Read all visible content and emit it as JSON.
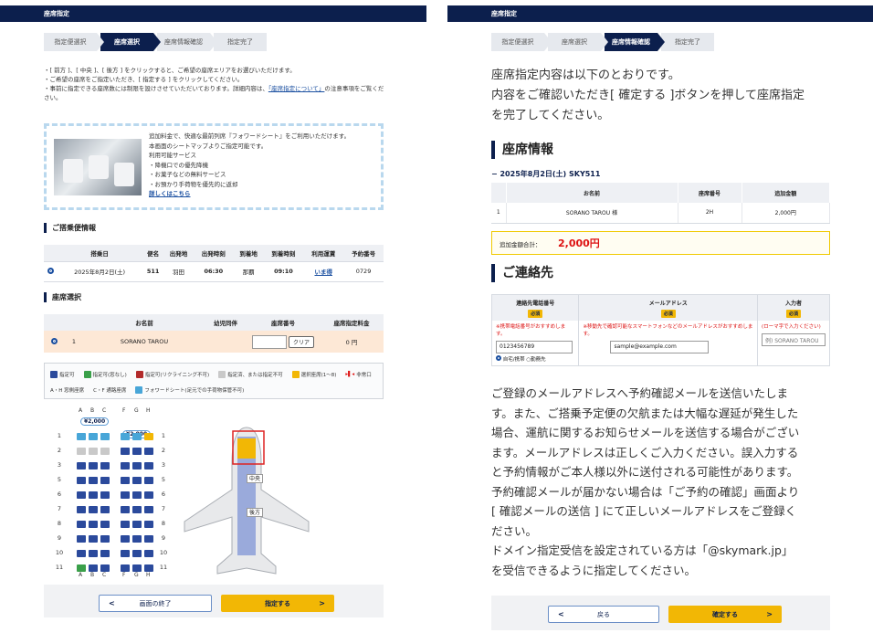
{
  "left": {
    "header_title": "座席指定",
    "steps": [
      "指定便選択",
      "座席選択",
      "座席情報確認",
      "指定完了"
    ],
    "notes": [
      "・[ 前方 ]、[ 中央 ]、[ 後方 ] をクリックすると、ご希望の座席エリアをお選びいただけます。",
      "・ご希望の座席をご指定いただき、[ 指定する ] をクリックしてください。",
      "・事前に指定できる座席数には制限を設けさせていただいております。詳細内容は、"
    ],
    "notes_link": "「座席指定について」",
    "notes_tail": "の注意事項をご覧ください。",
    "promo_lines": [
      "追加料金で、快適な最前列席『フォワードシート』をご利用いただけます。",
      "本画面のシートマップよりご指定可能です。",
      "利用可能サービス",
      "・降機口での優先降機",
      "・お菓子などの無料サービス",
      "・お預かり手荷物を優先的に返却"
    ],
    "promo_link": "詳しくはこちら",
    "flight_section": "ご搭乗便情報",
    "flight_headers": [
      "",
      "搭乗日",
      "便名",
      "出発地",
      "出発時刻",
      "到着地",
      "到着時刻",
      "利用運賃",
      "予約番号"
    ],
    "flight_row": {
      "date": "2025年8月2日(土)",
      "flight": "511",
      "from": "羽田",
      "dep": "06:30",
      "to": "那覇",
      "arr": "09:10",
      "fare": "いま得",
      "resno": "0729"
    },
    "seat_section": "座席選択",
    "seat_headers": [
      "",
      "",
      "お名前",
      "幼児同伴",
      "座席番号",
      "座席指定料金"
    ],
    "seat_row": {
      "no": "1",
      "name": "SORANO TAROU",
      "clear": "クリア",
      "fee": "0 円"
    },
    "legend": [
      "指定可",
      "指定可(窓なし)",
      "指定可(リクライニング不可)",
      "指定済、または指定不可",
      "選択座席(1〜8)",
      "非常口",
      "A・H 窓側座席",
      "C・F 通路座席",
      "フォワードシート(足元での手荷物保管不可)"
    ],
    "seat_cols": [
      "A",
      "B",
      "C",
      "F",
      "G",
      "H"
    ],
    "rows": [
      "1",
      "2",
      "3",
      "5",
      "6",
      "7",
      "8",
      "9",
      "10",
      "11"
    ],
    "forward_price": "¥2,000",
    "plane_mid": "中央",
    "plane_rear": "後方",
    "btn_back": "画面の終了",
    "btn_next": "指定する",
    "colors": {
      "available": "#2b4a9c",
      "no_window": "#3aa04a",
      "no_recline": "#b22b2b",
      "taken": "#c9c9c9",
      "selected": "#f2b705",
      "forward": "#48a6d8"
    }
  },
  "right": {
    "header_title": "座席指定",
    "steps": [
      "指定便選択",
      "座席選択",
      "座席情報確認",
      "指定完了"
    ],
    "intro": [
      "座席指定内容は以下のとおりです。",
      "内容をご確認いただき[ 確定する ]ボタンを押して座席指定",
      "を完了してください。"
    ],
    "seat_info_title": "座席情報",
    "flight_line": "− 2025年8月2日(土) SKY511",
    "table_headers": [
      "",
      "お名前",
      "座席番号",
      "追加金額"
    ],
    "table_row": {
      "no": "1",
      "name": "SORANO TAROU 様",
      "seat": "2H",
      "fee": "2,000円"
    },
    "total_label": "追加金額合計：",
    "total_value": "2,000円",
    "contact_title": "ご連絡先",
    "contact_headers": [
      "連絡先電話番号",
      "メールアドレス",
      "入力者"
    ],
    "required": "必須",
    "phone_warn": "※携帯電話番号がおすすめします。",
    "email_warn": "※移動先で確認可能なスマートフォンなどのメールアドレスがおすすめします。",
    "name_warn": "(ローマ字で入力ください)",
    "phone_value": "0123456789",
    "phone_opts": [
      "自宅/携帯",
      "勤務先"
    ],
    "email_value": "sample@example.com",
    "name_placeholder": "例) SORANO TAROU",
    "body": [
      "ご登録のメールアドレスへ予約確認メールを送信いたしま",
      "す。また、ご搭乗予定便の欠航または大幅な遅延が発生した",
      "場合、運航に関するお知らせメールを送信する場合がござい",
      "ます。メールアドレスは正しくご入力ください。誤入力する",
      "と予約情報がご本人様以外に送付される可能性があります。",
      "予約確認メールが届かない場合は「ご予約の確認」画面より",
      "[ 確認メールの送信 ] にて正しいメールアドレスをご登録く",
      "ださい。",
      "ドメイン指定受信を設定されている方は「@skymark.jp」",
      "を受信できるように指定してください。"
    ],
    "btn_back": "戻る",
    "btn_confirm": "確定する"
  }
}
